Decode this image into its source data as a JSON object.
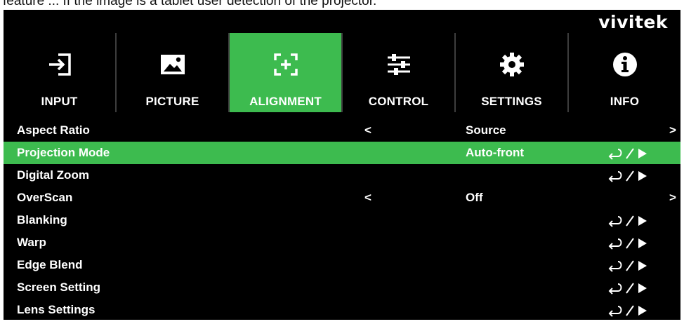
{
  "caption": "feature ... If the image is a tablet user detection of the projector.",
  "brand": "vivitek",
  "tabs": [
    {
      "label": "INPUT",
      "icon": "input-icon"
    },
    {
      "label": "PICTURE",
      "icon": "picture-icon"
    },
    {
      "label": "ALIGNMENT",
      "icon": "alignment-icon",
      "active": true
    },
    {
      "label": "CONTROL",
      "icon": "control-sliders-icon"
    },
    {
      "label": "SETTINGS",
      "icon": "gear-icon"
    },
    {
      "label": "INFO",
      "icon": "info-icon"
    }
  ],
  "menu": {
    "aspect_ratio": {
      "label": "Aspect Ratio",
      "left": "<",
      "value": "Source",
      "right": ">"
    },
    "projection_mode": {
      "label": "Projection Mode",
      "value": "Auto-front"
    },
    "digital_zoom": {
      "label": "Digital Zoom"
    },
    "overscan": {
      "label": "OverScan",
      "left": "<",
      "value": "Off",
      "right": ">"
    },
    "blanking": {
      "label": "Blanking"
    },
    "warp": {
      "label": "Warp"
    },
    "edge_blend": {
      "label": "Edge Blend"
    },
    "screen_setting": {
      "label": "Screen Setting"
    },
    "lens_settings": {
      "label": "Lens Settings"
    }
  },
  "colors": {
    "accent": "#3dbb4f",
    "background": "#000000",
    "text": "#ffffff"
  }
}
